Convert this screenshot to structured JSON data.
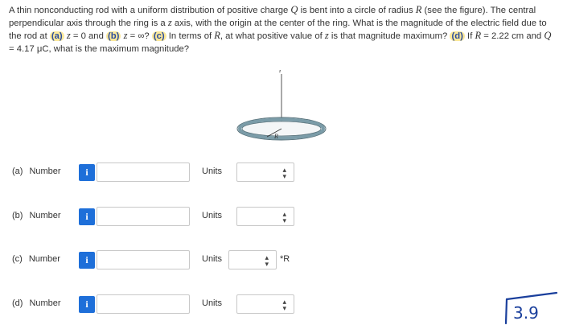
{
  "question": {
    "s1": "A thin nonconducting rod with a uniform distribution of positive charge ",
    "q": "Q",
    "s2": " is bent into a circle of radius ",
    "r": "R",
    "s3": " (see the figure). The central perpendicular axis through the ring is a ",
    "z1": "z",
    "s4": " axis, with the origin at the center of the ring. What is the magnitude of the electric field due to the rod at ",
    "a": "(a)",
    "z2": "z",
    "s5": " = 0 and ",
    "b": "(b)",
    "z3": "z",
    "s6": " = ∞? ",
    "c": "(c)",
    "s7": " In terms of ",
    "r2": "R",
    "s8": ", at what positive value of ",
    "z4": "z",
    "s9": " is that magnitude maximum? ",
    "d": "(d)",
    "s10": " If ",
    "r3": "R",
    "s11": " = 2.22 cm and ",
    "q2": "Q",
    "s12": " = 4.17 μC, what is the maximum magnitude?"
  },
  "figure": {
    "axis_label": "z",
    "radius_label": "R",
    "ring_color": "#7b9ca8"
  },
  "rows": [
    {
      "part": "(a)",
      "label": "Number",
      "info": "i",
      "value": "",
      "units_label": "Units",
      "units_value": "",
      "suffix": ""
    },
    {
      "part": "(b)",
      "label": "Number",
      "info": "i",
      "value": "",
      "units_label": "Units",
      "units_value": "",
      "suffix": ""
    },
    {
      "part": "(c)",
      "label": "Number",
      "info": "i",
      "value": "",
      "units_label": "Units",
      "units_value": "",
      "suffix": "*R"
    },
    {
      "part": "(d)",
      "label": "Number",
      "info": "i",
      "value": "",
      "units_label": "Units",
      "units_value": "",
      "suffix": ""
    }
  ],
  "chevron_icon": "⌃⌄",
  "annotation": "3.9",
  "colors": {
    "info_button": "#1e6fd9",
    "highlight": "#fbe89a",
    "annotation_ink": "#1a3f9c"
  }
}
